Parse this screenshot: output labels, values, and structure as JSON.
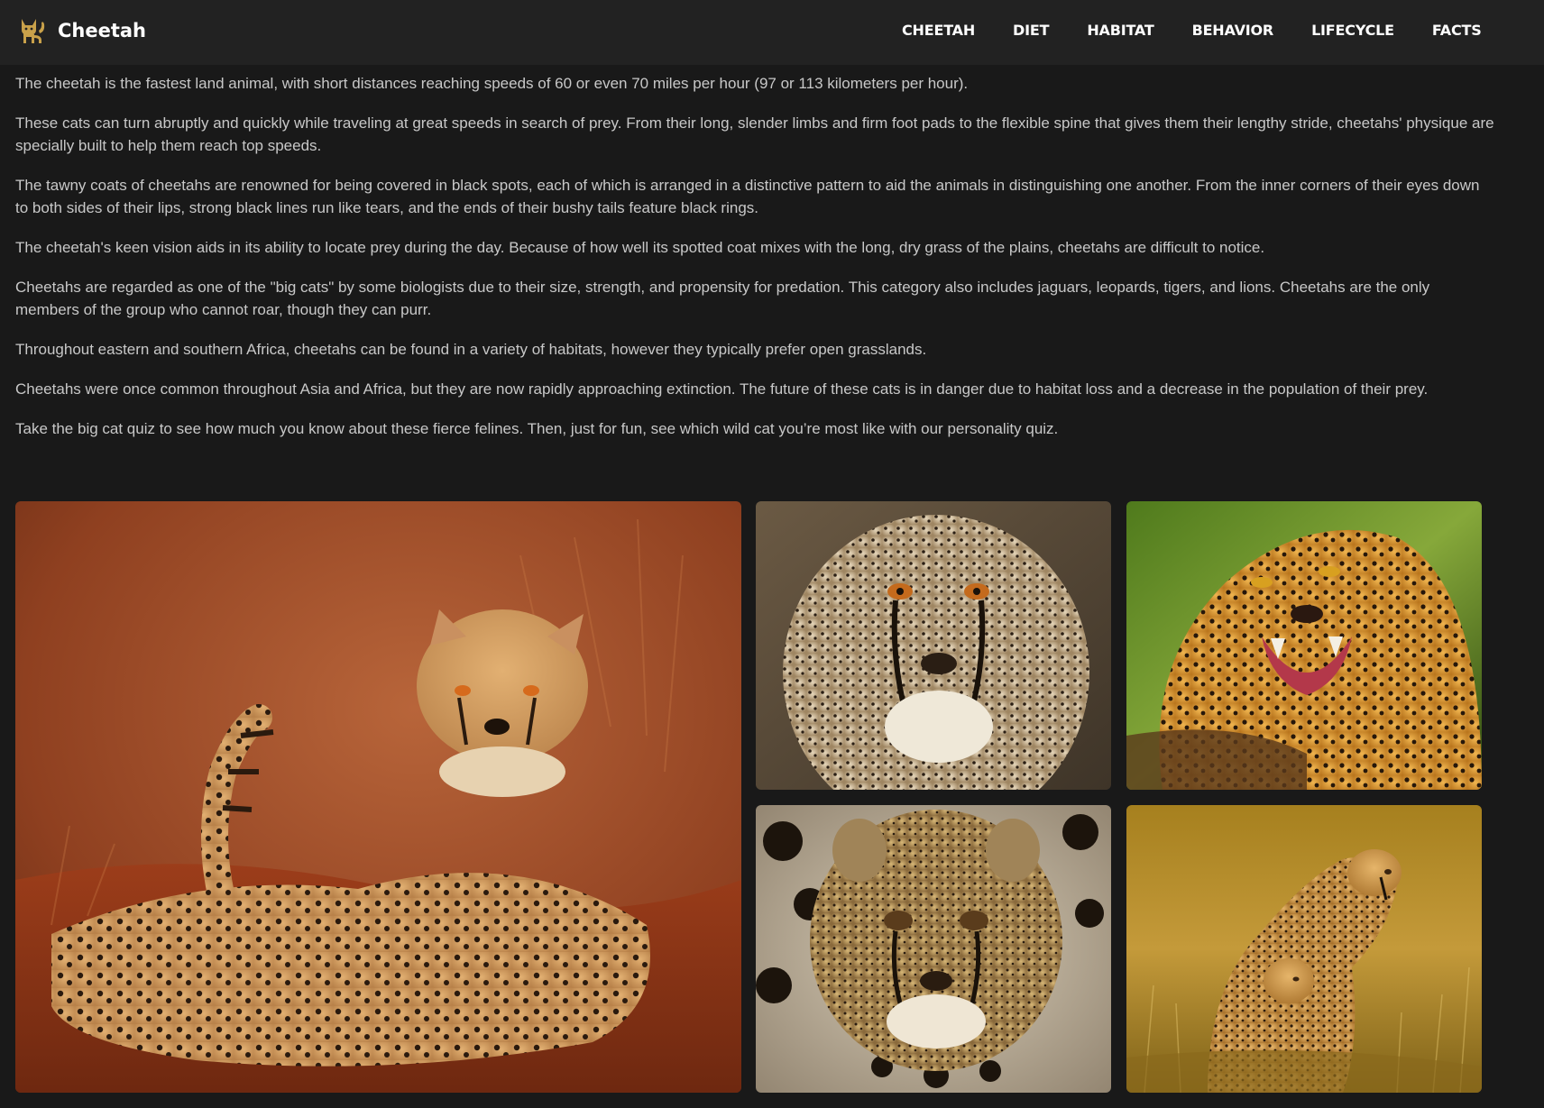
{
  "brand": {
    "name": "Cheetah",
    "icon": "cat-icon"
  },
  "nav": {
    "items": [
      {
        "label": "CHEETAH"
      },
      {
        "label": "DIET"
      },
      {
        "label": "HABITAT"
      },
      {
        "label": "BEHAVIOR"
      },
      {
        "label": "LIFECYCLE"
      },
      {
        "label": "FACTS"
      }
    ]
  },
  "article": {
    "paragraphs": [
      "The cheetah is the fastest land animal, with short distances reaching speeds of 60 or even 70 miles per hour (97 or 113 kilometers per hour).",
      "These cats can turn abruptly and quickly while traveling at great speeds in search of prey. From their long, slender limbs and firm foot pads to the flexible spine that gives them their lengthy stride, cheetahs' physique are specially built to help them reach top speeds.",
      "The tawny coats of cheetahs are renowned for being covered in black spots, each of which is arranged in a distinctive pattern to aid the animals in distinguishing one another. From the inner corners of their eyes down to both sides of their lips, strong black lines run like tears, and the ends of their bushy tails feature black rings.",
      "The cheetah's keen vision aids in its ability to locate prey during the day. Because of how well its spotted coat mixes with the long, dry grass of the plains, cheetahs are difficult to notice.",
      "Cheetahs are regarded as one of the \"big cats\" by some biologists due to their size, strength, and propensity for predation. This category also includes jaguars, leopards, tigers, and lions. Cheetahs are the only members of the group who cannot roar, though they can purr.",
      "Throughout eastern and southern Africa, cheetahs can be found in a variety of habitats, however they typically prefer open grasslands.",
      "Cheetahs were once common throughout Asia and Africa, but they are now rapidly approaching extinction. The future of these cats is in danger due to habitat loss and a decrease in the population of their prey.",
      "Take the big cat quiz to see how much you know about these fierce felines. Then, just for fun, see which wild cat you’re most like with our personality quiz."
    ]
  },
  "colors": {
    "page_bg": "#191919",
    "navbar_bg": "#222222",
    "text": "#c8c8c8",
    "nav_text": "#ffffff",
    "brand_icon": "#c9a14a"
  }
}
